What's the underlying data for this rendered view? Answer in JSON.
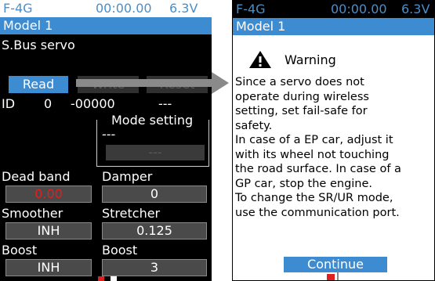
{
  "status": {
    "model_short": "F-4G",
    "timer": "00:00.00",
    "voltage": "6.3V"
  },
  "model_name": "Model 1",
  "left": {
    "screen_title": "S.Bus servo",
    "buttons": {
      "read": "Read",
      "write": "Write",
      "reset": "Reset"
    },
    "id_row": {
      "label": "ID",
      "channel": "0",
      "id_value": "-00000",
      "extra": "---"
    },
    "mode_setting": {
      "label": "Mode setting",
      "value": "---",
      "button": "---"
    },
    "params": [
      {
        "label": "Dead band",
        "value": "0.00",
        "highlight": true
      },
      {
        "label": "Damper",
        "value": "0",
        "highlight": false
      },
      {
        "label": "Smoother",
        "value": "INH",
        "highlight": false
      },
      {
        "label": "Stretcher",
        "value": "0.125",
        "highlight": false
      },
      {
        "label": "Boost",
        "value": "INH",
        "highlight": false
      },
      {
        "label": "Boost",
        "value": "3",
        "highlight": false
      }
    ]
  },
  "right": {
    "warning_title": "Warning",
    "warning_lines": [
      " Since a servo does not",
      "operate during wireless",
      "setting, set fail-safe for",
      "safety.",
      " In case of a EP car, adjust it",
      "with its wheel not touching",
      "the road surface. In case of a",
      "GP car, stop the engine.",
      " To change the SR/UR mode,",
      "use the communication port."
    ],
    "continue_button": "Continue"
  },
  "colors": {
    "accent": "#3d8bd0",
    "highlight_value": "#e02020",
    "arrow": "#8a8a8a"
  }
}
